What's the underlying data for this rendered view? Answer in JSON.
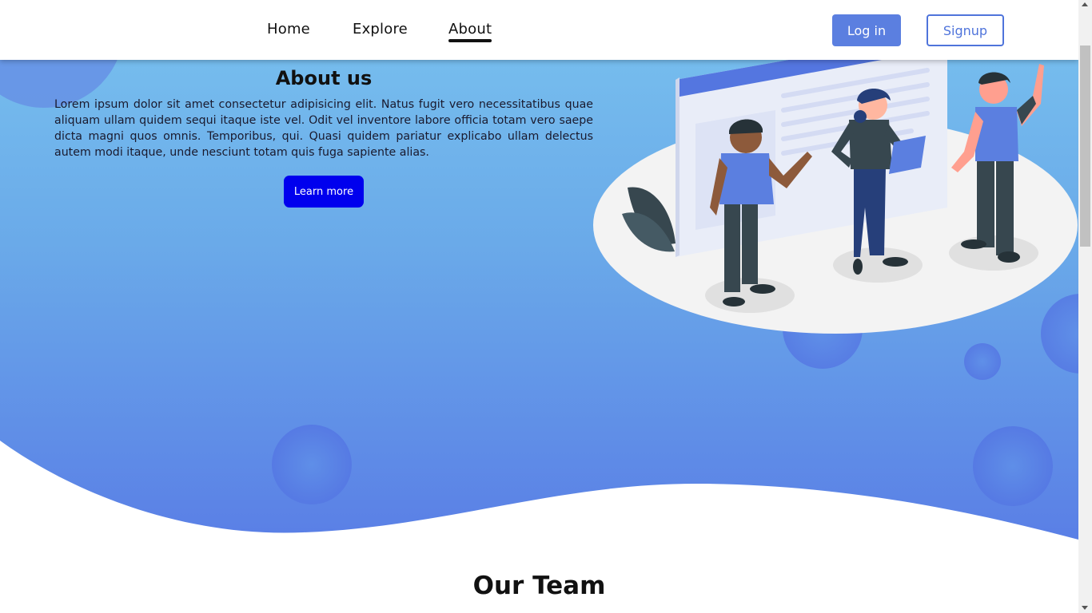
{
  "nav": {
    "links": [
      {
        "label": "Home"
      },
      {
        "label": "Explore"
      },
      {
        "label": "About"
      }
    ],
    "active": "About",
    "login_label": "Log in",
    "signup_label": "Signup"
  },
  "about": {
    "title": "About us",
    "body": "Lorem ipsum dolor sit amet consectetur adipisicing elit. Natus fugit vero necessitatibus quae aliquam ullam quidem sequi itaque iste vel. Odit vel inventore labore officia totam vero saepe dicta magni quos omnis. Temporibus, qui. Quasi quidem pariatur explicabo ullam delectus autem modi itaque, unde nesciunt totam quis fuga sapiente alias.",
    "button_label": "Learn more"
  },
  "team": {
    "title": "Our Team"
  },
  "colors": {
    "hero_top": "#78bdee",
    "hero_bottom": "#5a80e6",
    "primary_button": "#5b7fe0",
    "learn_more_button": "#0000ee",
    "signup_border": "#4f74db"
  },
  "icons": {
    "illustration": "team-meeting-illustration"
  }
}
